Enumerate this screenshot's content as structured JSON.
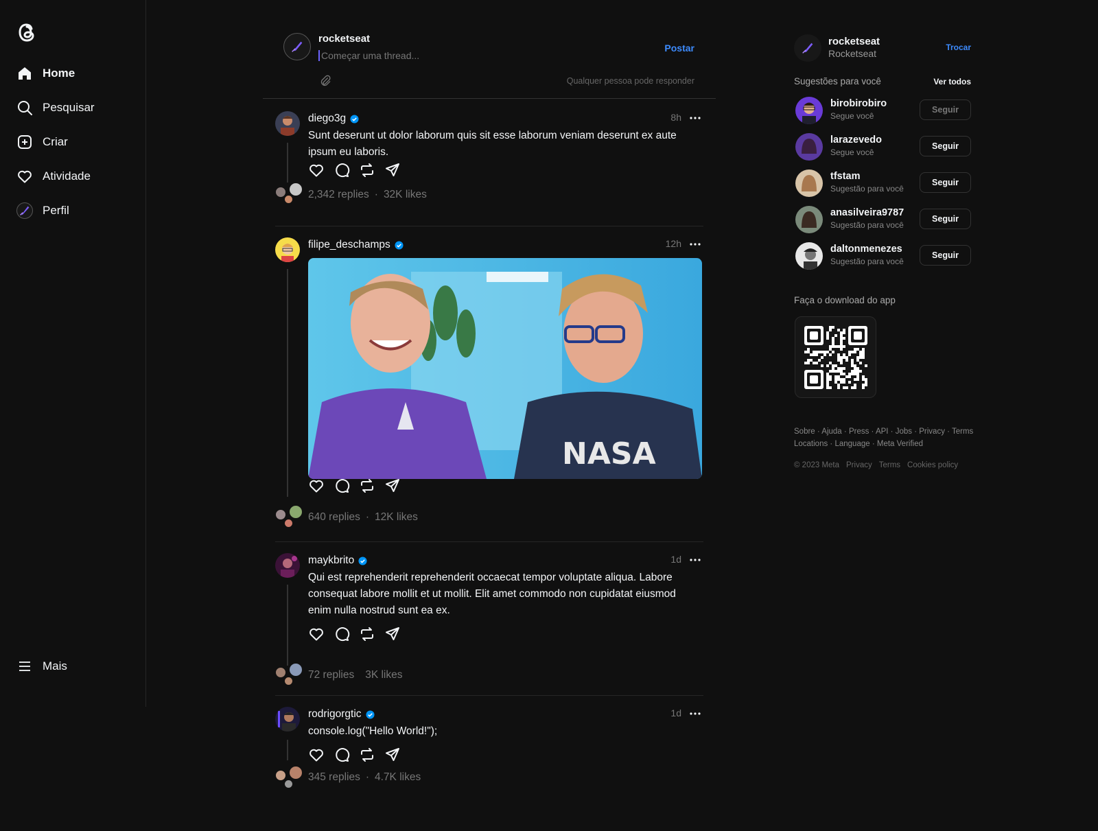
{
  "sidebar": {
    "logo": "threads-logo",
    "items": [
      {
        "label": "Home",
        "icon": "home-icon"
      },
      {
        "label": "Pesquisar",
        "icon": "search-icon"
      },
      {
        "label": "Criar",
        "icon": "create-icon"
      },
      {
        "label": "Atividade",
        "icon": "heart-icon"
      },
      {
        "label": "Perfil",
        "icon": "profile-avatar"
      }
    ],
    "more": {
      "label": "Mais",
      "icon": "menu-icon"
    }
  },
  "composer": {
    "username": "rocketseat",
    "placeholder": "Começar uma thread...",
    "post_label": "Postar",
    "reply_note": "Qualquer pessoa pode responder"
  },
  "posts": [
    {
      "username": "diego3g",
      "time": "8h",
      "text": "Sunt deserunt ut dolor laborum quis sit esse laborum veniam deserunt ex aute ipsum eu laboris.",
      "replies": "2,342 replies",
      "likes": "32K likes"
    },
    {
      "username": "filipe_deschamps",
      "time": "12h",
      "image": "photo-two-men-laughing",
      "image_shirt_text": "NASA",
      "replies": "640 replies",
      "likes": "12K likes"
    },
    {
      "username": "maykbrito",
      "time": "1d",
      "text": "Qui est reprehenderit reprehenderit occaecat tempor voluptate aliqua. Labore consequat labore mollit et ut mollit. Elit amet commodo non cupidatat eiusmod enim nulla nostrud sunt ea ex.",
      "replies": "72 replies",
      "likes": "3K likes"
    },
    {
      "username": "rodrigorgtic",
      "time": "1d",
      "text": "console.log(\"Hello World!\");",
      "replies": "345 replies",
      "likes": "4.7K likes"
    }
  ],
  "stat_separator": "·",
  "right": {
    "username": "rocketseat",
    "name": "Rocketseat",
    "switch_label": "Trocar",
    "suggestions_title": "Sugestões para você",
    "see_all": "Ver todos",
    "suggestions": [
      {
        "username": "birobirobiro",
        "subtitle": "Segue você",
        "button": "Seguir",
        "muted": true
      },
      {
        "username": "larazevedo",
        "subtitle": "Segue você",
        "button": "Seguir"
      },
      {
        "username": "tfstam",
        "subtitle": "Sugestão para você",
        "button": "Seguir"
      },
      {
        "username": "anasilveira9787",
        "subtitle": "Sugestão para você",
        "button": "Seguir"
      },
      {
        "username": "daltonmenezes",
        "subtitle": "Sugestão para você",
        "button": "Seguir"
      }
    ],
    "download_title": "Faça o download  do app",
    "footer_links": [
      "Sobre",
      "Ajuda",
      "Press",
      "API",
      "Jobs",
      "Privacy",
      "Terms",
      "Locations",
      "Language",
      "Meta Verified"
    ],
    "footer_bottom": [
      "© 2023 Meta",
      "Privacy",
      "Terms",
      "Cookies policy"
    ]
  },
  "colors": {
    "background": "#101010",
    "accent": "#3d8bfd",
    "verified": "#0095f6"
  }
}
